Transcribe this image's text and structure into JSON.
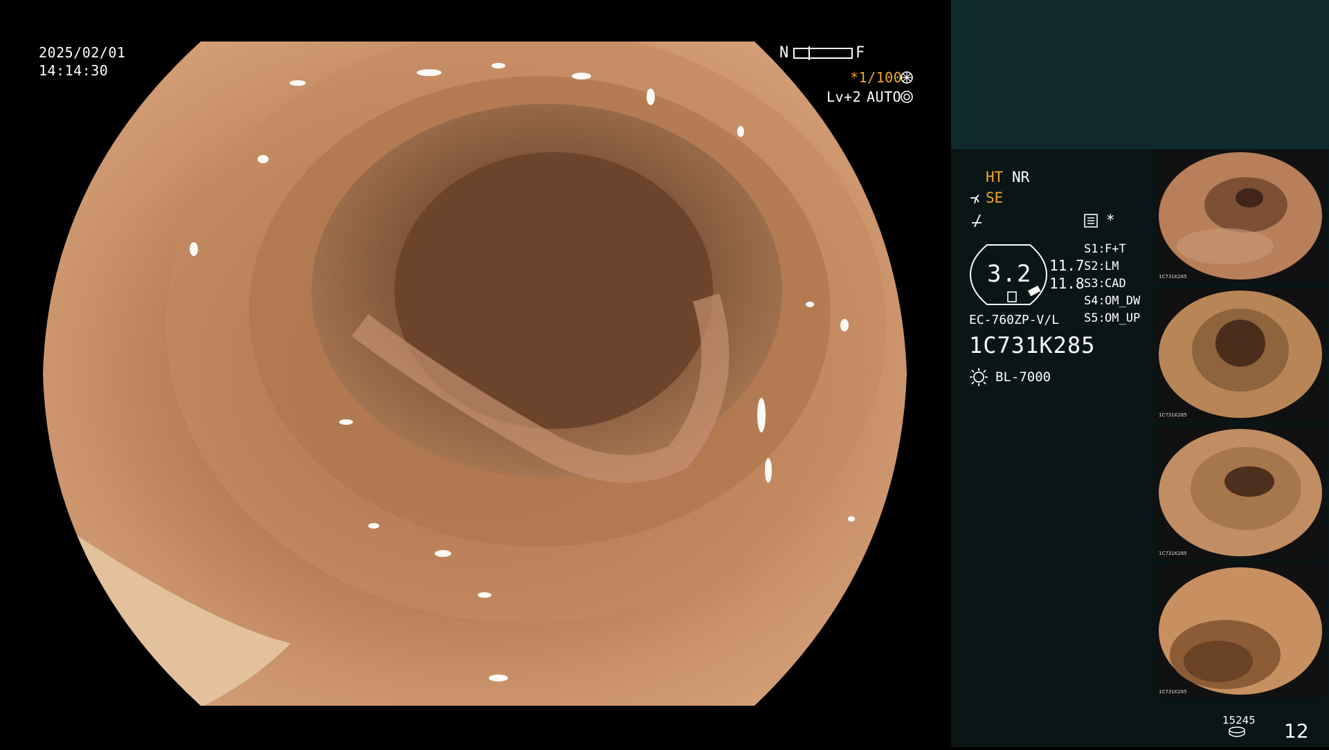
{
  "header": {
    "date": "2025/02/01",
    "time": "14:14:30"
  },
  "scope_status": {
    "near_label": "N",
    "far_label": "F",
    "shutter": "*1/100",
    "level": "Lv+2",
    "mode": "AUTO"
  },
  "settings": {
    "ht": "HT",
    "nr": "NR",
    "se": "SE",
    "asterisk": "*",
    "gauge_value": "3.2",
    "val1": "11.7",
    "val2": "11.8",
    "s1_label": "S1:",
    "s1_value": "F+T",
    "s2_label": "S2:",
    "s2_value": "LM",
    "s3_label": "S3:",
    "s3_value": "CAD",
    "s4_label": "S4:",
    "s4_value": "OM_DW",
    "s5_label": "S5:",
    "s5_value": "OM_UP",
    "scope_model": "EC-760ZP-V/L",
    "serial": "1C731K285",
    "light_source": "BL-7000"
  },
  "footer": {
    "count": "15245",
    "page": "12"
  },
  "thumbnails": [
    {
      "caption": "1C731K285"
    },
    {
      "caption": "1C731K285"
    },
    {
      "caption": "1C731K285"
    },
    {
      "caption": "1C731K285"
    }
  ],
  "colors": {
    "accent_orange": "#f5a623",
    "panel_top": "#0f2b2d",
    "panel": "#0a1516"
  }
}
